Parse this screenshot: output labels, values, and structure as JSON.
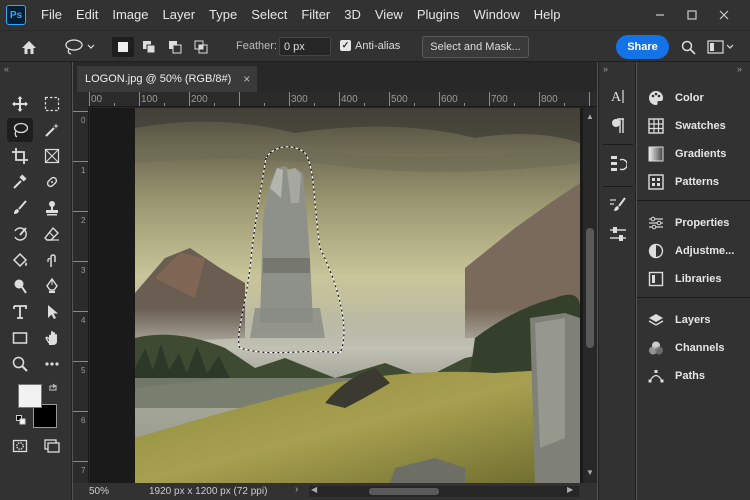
{
  "app": {
    "logo_text": "Ps"
  },
  "menu": [
    "File",
    "Edit",
    "Image",
    "Layer",
    "Type",
    "Select",
    "Filter",
    "3D",
    "View",
    "Plugins",
    "Window",
    "Help"
  ],
  "options": {
    "feather_label": "Feather:",
    "feather_value": "0 px",
    "antialias_label": "Anti-alias",
    "antialias_checked": true,
    "select_and_mask": "Select and Mask...",
    "share": "Share"
  },
  "document": {
    "tab_title": "LOGON.jpg @ 50% (RGB/8#)",
    "ruler_ticks": [
      "00",
      "100",
      "200",
      "300",
      "400",
      "500",
      "600",
      "700",
      "800"
    ],
    "vruler_labels": [
      "0",
      "1",
      "2",
      "3",
      "4",
      "5",
      "6",
      "7"
    ]
  },
  "status": {
    "zoom": "50%",
    "info": "1920 px x 1200 px (72 ppi)"
  },
  "panels": {
    "group1": [
      "Color",
      "Swatches",
      "Gradients",
      "Patterns"
    ],
    "group2": [
      "Properties",
      "Adjustme...",
      "Libraries"
    ],
    "group3": [
      "Layers",
      "Channels",
      "Paths"
    ]
  },
  "colors": {
    "accent": "#1473e6",
    "foreground": "#f2f2f2",
    "background": "#000000"
  }
}
